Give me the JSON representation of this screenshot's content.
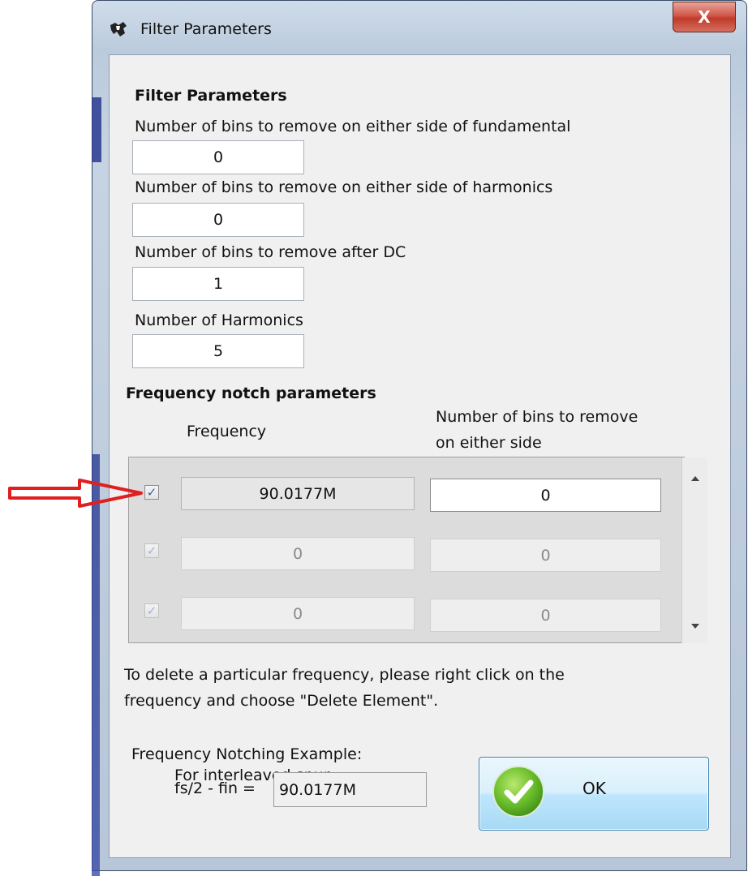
{
  "window": {
    "title": "Filter Parameters",
    "close_label": "X"
  },
  "filter_section": {
    "heading": "Filter Parameters",
    "fields": [
      {
        "label": "Number of bins to remove on either side of fundamental",
        "value": "0"
      },
      {
        "label": "Number of bins to remove on either side of harmonics",
        "value": "0"
      },
      {
        "label": "Number of bins to remove after DC",
        "value": "1"
      },
      {
        "label": "Number of Harmonics",
        "value": "5"
      }
    ]
  },
  "notch_section": {
    "heading": "Frequency notch parameters",
    "col_frequency": "Frequency",
    "col_bins_line1": "Number of bins to remove",
    "col_bins_line2": "on either side",
    "rows": [
      {
        "checked": true,
        "enabled": true,
        "frequency": "90.0177M",
        "bins": "0"
      },
      {
        "checked": true,
        "enabled": false,
        "frequency": "0",
        "bins": "0"
      },
      {
        "checked": true,
        "enabled": false,
        "frequency": "0",
        "bins": "0"
      }
    ]
  },
  "help": {
    "line1": "To delete a particular frequency, please right click on the",
    "line2": "frequency and choose \"Delete Element\"."
  },
  "example": {
    "title": "Frequency Notching Example:",
    "subtitle": "For interleaved spur,",
    "formula_label": "fs/2 - fin =",
    "formula_value": "90.0177M"
  },
  "ok_button": {
    "label": "OK"
  },
  "colors": {
    "annotation_arrow": "#e02020",
    "window_frame": "#bccbdc",
    "client_bg": "#f0f0f0"
  }
}
